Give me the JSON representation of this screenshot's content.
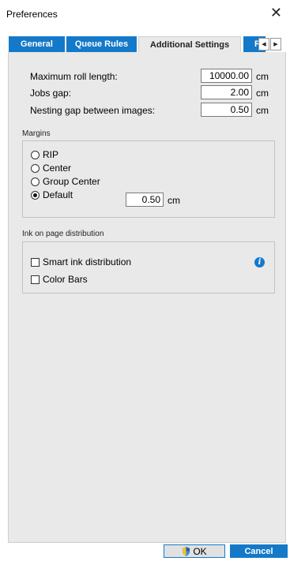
{
  "window": {
    "title": "Preferences",
    "close_icon": "close-icon"
  },
  "tabs": [
    {
      "label": "General",
      "active": false
    },
    {
      "label": "Queue Rules",
      "active": false
    },
    {
      "label": "Additional Settings",
      "active": true
    },
    {
      "label": "R",
      "active": false
    }
  ],
  "tab_scroll": {
    "left": "◀",
    "right": "▶"
  },
  "settings": {
    "max_roll_length": {
      "label": "Maximum roll length:",
      "value": "10000.00",
      "unit": "cm"
    },
    "jobs_gap": {
      "label": "Jobs gap:",
      "value": "2.00",
      "unit": "cm"
    },
    "nesting_gap": {
      "label": "Nesting gap between images:",
      "value": "0.50",
      "unit": "cm"
    }
  },
  "margins": {
    "title": "Margins",
    "options": [
      {
        "label": "RIP",
        "selected": false
      },
      {
        "label": "Center",
        "selected": false
      },
      {
        "label": "Group Center",
        "selected": false
      },
      {
        "label": "Default",
        "selected": true
      }
    ],
    "default_value": "0.50",
    "unit": "cm"
  },
  "ink": {
    "title": "Ink on page distribution",
    "options": [
      {
        "label": "Smart ink distribution",
        "checked": false
      },
      {
        "label": "Color Bars",
        "checked": false
      }
    ],
    "info_icon": "info-icon"
  },
  "buttons": {
    "ok": "OK",
    "cancel": "Cancel"
  },
  "colors": {
    "accent": "#1479c9",
    "panel": "#e9e9e9"
  }
}
